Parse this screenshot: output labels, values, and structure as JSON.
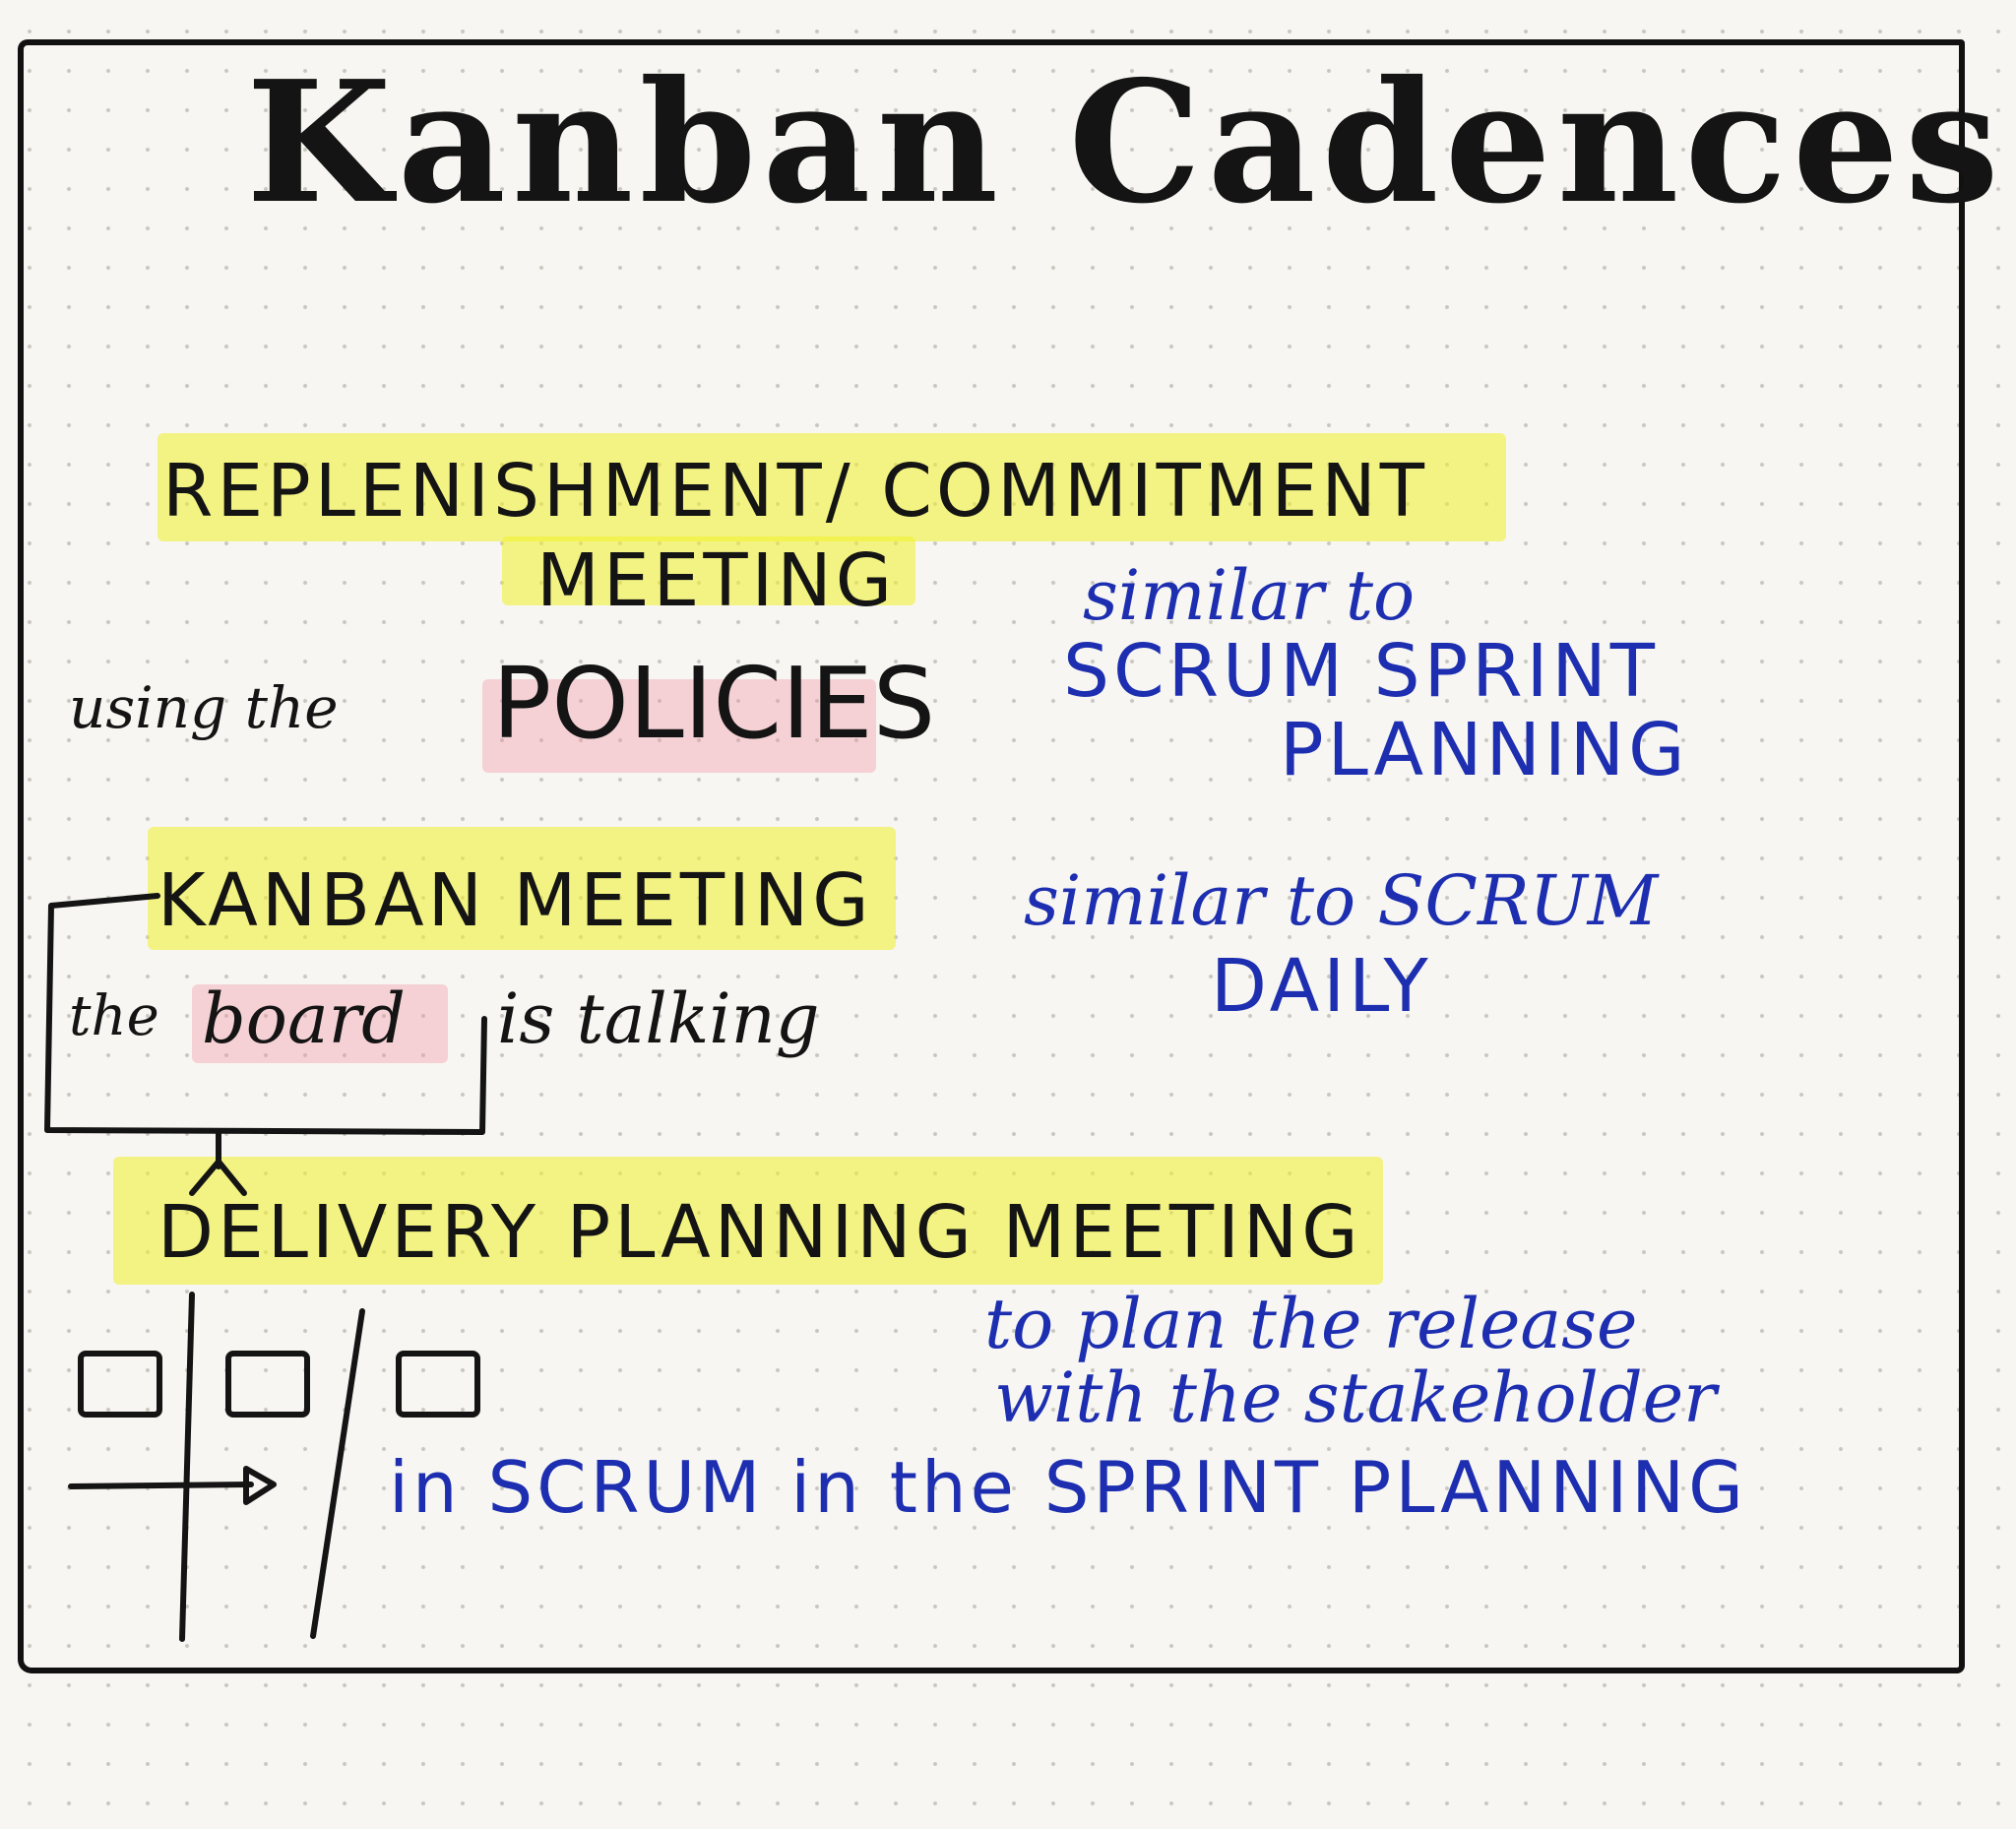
{
  "title": "Kanban Cadences",
  "replenishment": {
    "heading_line1": "REPLENISHMENT/ COMMITMENT",
    "heading_line2": "MEETING",
    "note": "using the",
    "note_emphasis": "POLICIES",
    "comparison_line1": "similar to",
    "comparison_line2": "SCRUM SPRINT",
    "comparison_line3": "PLANNING"
  },
  "kanban_meeting": {
    "heading": "KANBAN MEETING",
    "note_start": "the",
    "note_emphasis": "board",
    "note_end": "is talking",
    "comparison_line1": "similar to SCRUM",
    "comparison_line2": "DAILY"
  },
  "delivery": {
    "heading": "DELIVERY PLANNING MEETING",
    "purpose_line1": "to plan the release",
    "purpose_line2": "with the stakeholder",
    "scrum_note": "in SCRUM in the SPRINT PLANNING"
  },
  "colors": {
    "ink_black": "#141414",
    "ink_blue": "#1d2fb0",
    "highlighter_yellow": "#f0f028",
    "highlighter_pink": "#f08ca0",
    "paper": "#f7f6f2"
  }
}
